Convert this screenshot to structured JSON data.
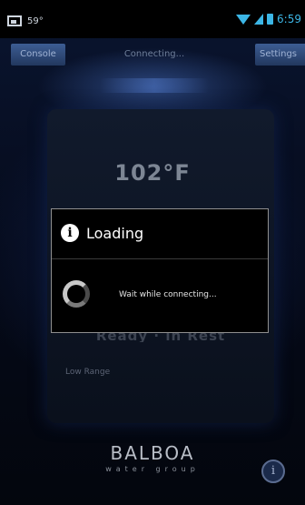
{
  "status_bar": {
    "temperature": "59°",
    "time": "6:59",
    "icons": [
      "image-notification-icon",
      "wifi-icon",
      "signal-icon",
      "battery-icon"
    ]
  },
  "header": {
    "left_button": "Console",
    "title": "Connecting...",
    "right_button": "Settings"
  },
  "panel": {
    "temperature": "102°F",
    "ready_text": "Ready · in Rest",
    "range_label": "Low Range"
  },
  "dialog": {
    "title": "Loading",
    "message": "Wait while connecting..."
  },
  "brand": {
    "name": "BALBOA",
    "tagline": "water group"
  },
  "colors": {
    "accent": "#3cb6e6",
    "button": "#2e4a7a",
    "dialog_bg": "#000000"
  }
}
